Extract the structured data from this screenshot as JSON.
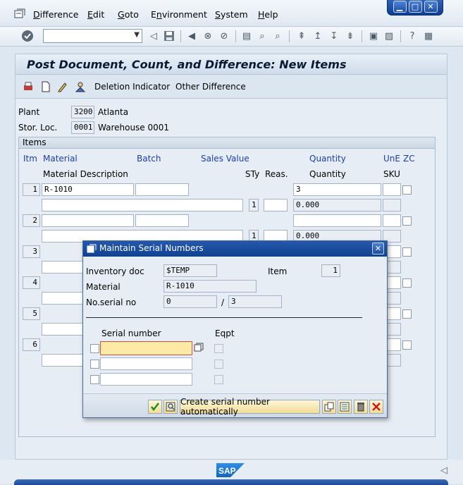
{
  "menu": [
    "Difference",
    "Edit",
    "Goto",
    "Environment",
    "System",
    "Help"
  ],
  "menu_access_keys": [
    "D",
    "E",
    "G",
    "n",
    "S",
    "H"
  ],
  "title": "Post Document, Count, and Difference: New Items",
  "app_toolbar": {
    "deletion_indicator": "Deletion Indicator",
    "other_difference": "Other Difference"
  },
  "header": {
    "plant_label": "Plant",
    "plant_value": "3200",
    "plant_name": "Atlanta",
    "storloc_label": "Stor. Loc.",
    "storloc_value": "0001",
    "storloc_name": "Warehouse 0001"
  },
  "items": {
    "title": "Items",
    "columns": {
      "itm": "Itm",
      "material": "Material",
      "batch": "Batch",
      "sales_value": "Sales Value",
      "quantity": "Quantity",
      "une": "UnE",
      "zc": "ZC",
      "material_description": "Material Description",
      "sty": "STy",
      "reas": "Reas.",
      "quantity2": "Quantity",
      "sku": "SKU"
    },
    "rows": [
      {
        "itm": "1",
        "material": "R-1010",
        "quantity": "3",
        "sty": "1",
        "quantity2": "0.000"
      },
      {
        "itm": "2",
        "material": "",
        "quantity": "",
        "sty": "1",
        "quantity2": "0.000"
      },
      {
        "itm": "3"
      },
      {
        "itm": "4"
      },
      {
        "itm": "5"
      },
      {
        "itm": "6"
      }
    ]
  },
  "dialog": {
    "title": "Maintain Serial Numbers",
    "inventory_doc_label": "Inventory doc",
    "inventory_doc_value": "$TEMP",
    "item_label": "Item",
    "item_value": "1",
    "material_label": "Material",
    "material_value": "R-1010",
    "no_serial_label": "No.serial no",
    "no_serial_value": "0",
    "no_serial_sep": "/",
    "no_serial_total": "3",
    "serial_col": "Serial number",
    "eqpt_col": "Eqpt",
    "create_button": "Create serial number automatically"
  },
  "colors": {
    "header_blue": "#1a3fb0",
    "dialog_title_bg": "#10418f",
    "focus_field": "#fde9a6"
  }
}
